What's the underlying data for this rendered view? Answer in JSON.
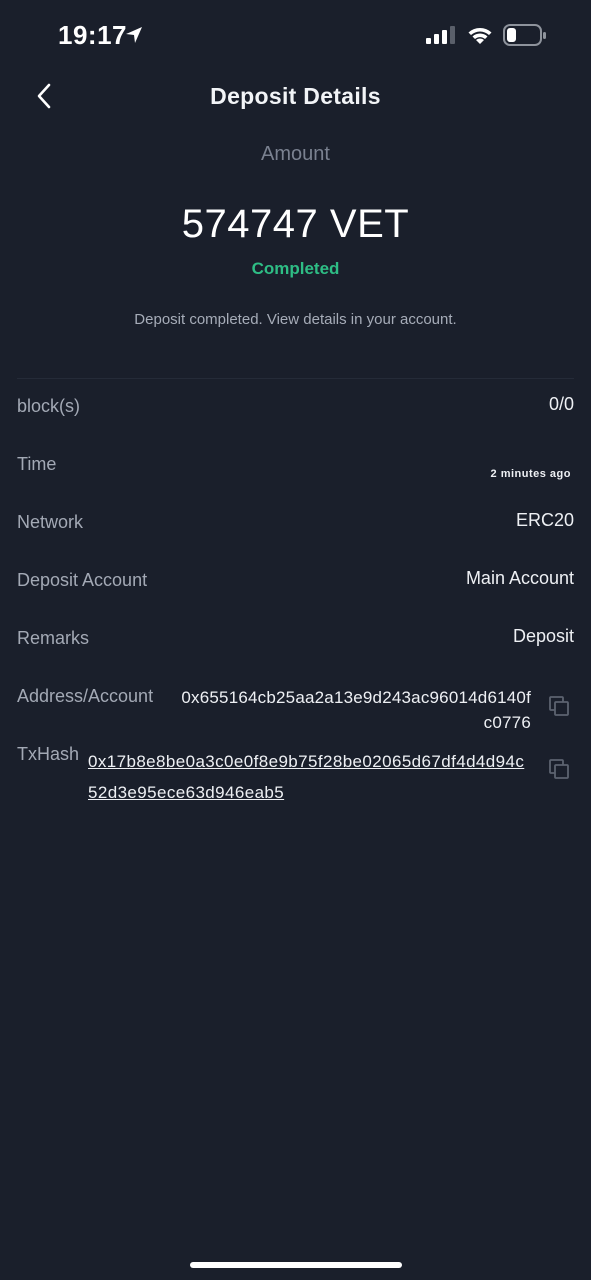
{
  "status_bar": {
    "time": "19:17",
    "icons": [
      "location-icon",
      "signal-icon",
      "wifi-icon",
      "battery-icon"
    ]
  },
  "header": {
    "title": "Deposit Details",
    "back_icon": "chevron-left-icon"
  },
  "summary": {
    "amount_label": "Amount",
    "amount_value": "574747 VET",
    "status": "Completed",
    "description": "Deposit completed. View details in your account."
  },
  "details": {
    "blocks": {
      "label": "block(s)",
      "value": "0/0"
    },
    "time": {
      "label": "Time",
      "value": "2 minutes ago"
    },
    "network": {
      "label": "Network",
      "value": "ERC20"
    },
    "deposit_account": {
      "label": "Deposit Account",
      "value": "Main Account"
    },
    "remarks": {
      "label": "Remarks",
      "value": "Deposit"
    },
    "address": {
      "label": "Address/Account",
      "value": "0x655164cb25aa2a13e9d243ac96014d6140fc0776"
    },
    "txhash": {
      "label": "TxHash",
      "value": "0x17b8e8be0a3c0e0f8e9b75f28be02065d67df4d4d94c52d3e95ece63d946eab5"
    }
  },
  "colors": {
    "background": "#1a1f2b",
    "accent_green": "#2ebd85",
    "label_gray": "#a3a9b5"
  }
}
